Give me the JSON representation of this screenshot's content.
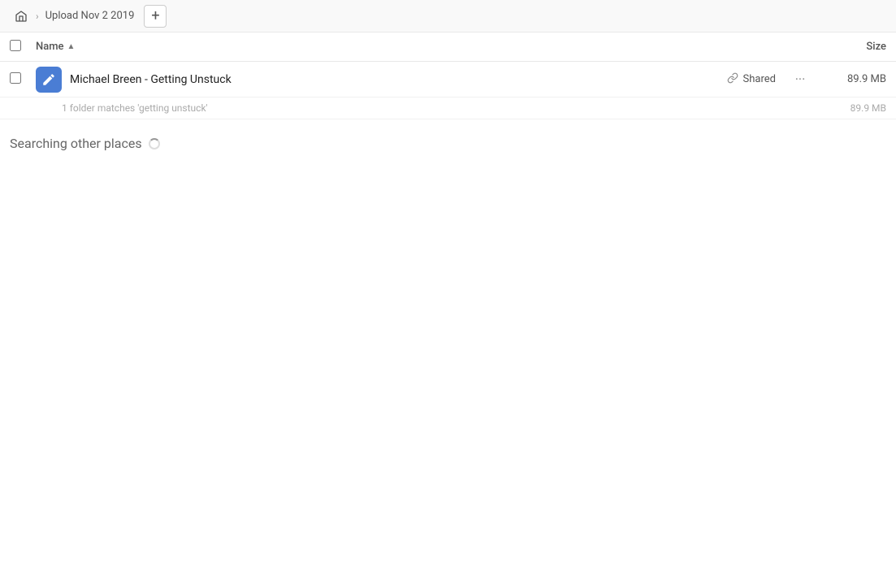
{
  "topbar": {
    "home_tooltip": "Home",
    "breadcrumb_item": "Upload Nov 2 2019",
    "add_button_label": "+"
  },
  "columns": {
    "name_label": "Name",
    "sort_indicator": "▲",
    "size_label": "Size"
  },
  "file_row": {
    "name": "Michael Breen - Getting Unstuck",
    "shared_label": "Shared",
    "size": "89.9 MB",
    "more_icon": "···"
  },
  "summary": {
    "text": "1 folder matches 'getting unstuck'",
    "size": "89.9 MB"
  },
  "searching": {
    "label": "Searching other places"
  },
  "icons": {
    "home": "🏠",
    "link": "🔗"
  }
}
